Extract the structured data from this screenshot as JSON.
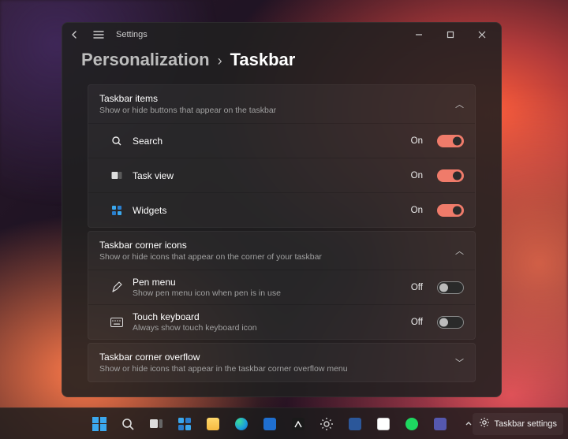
{
  "window": {
    "app_title": "Settings",
    "breadcrumb": {
      "parent": "Personalization",
      "sep": "›",
      "current": "Taskbar"
    }
  },
  "sections": {
    "items": {
      "title": "Taskbar items",
      "subtitle": "Show or hide buttons that appear on the taskbar",
      "rows": [
        {
          "icon": "search-icon",
          "label": "Search",
          "state": "On",
          "on": true
        },
        {
          "icon": "taskview-icon",
          "label": "Task view",
          "state": "On",
          "on": true
        },
        {
          "icon": "widgets-icon",
          "label": "Widgets",
          "state": "On",
          "on": true
        }
      ]
    },
    "corner_icons": {
      "title": "Taskbar corner icons",
      "subtitle": "Show or hide icons that appear on the corner of your taskbar",
      "rows": [
        {
          "icon": "pen-icon",
          "label": "Pen menu",
          "sub": "Show pen menu icon when pen is in use",
          "state": "Off",
          "on": false
        },
        {
          "icon": "keyboard-icon",
          "label": "Touch keyboard",
          "sub": "Always show touch keyboard icon",
          "state": "Off",
          "on": false
        }
      ]
    },
    "overflow": {
      "title": "Taskbar corner overflow",
      "subtitle": "Show or hide icons that appear in the taskbar corner overflow menu"
    }
  },
  "taskbar": {
    "icons": [
      "start-icon",
      "search-icon",
      "taskview-icon",
      "widgets-icon",
      "explorer-icon",
      "edge-icon",
      "outlook-icon",
      "rise-icon",
      "settings-icon",
      "word-icon",
      "calendar-icon",
      "spotify-icon",
      "teams-icon",
      "overflow-icon"
    ],
    "notification": {
      "icon": "gear-icon",
      "label": "Taskbar settings"
    }
  },
  "colors": {
    "accent": "#ef7b6a"
  }
}
